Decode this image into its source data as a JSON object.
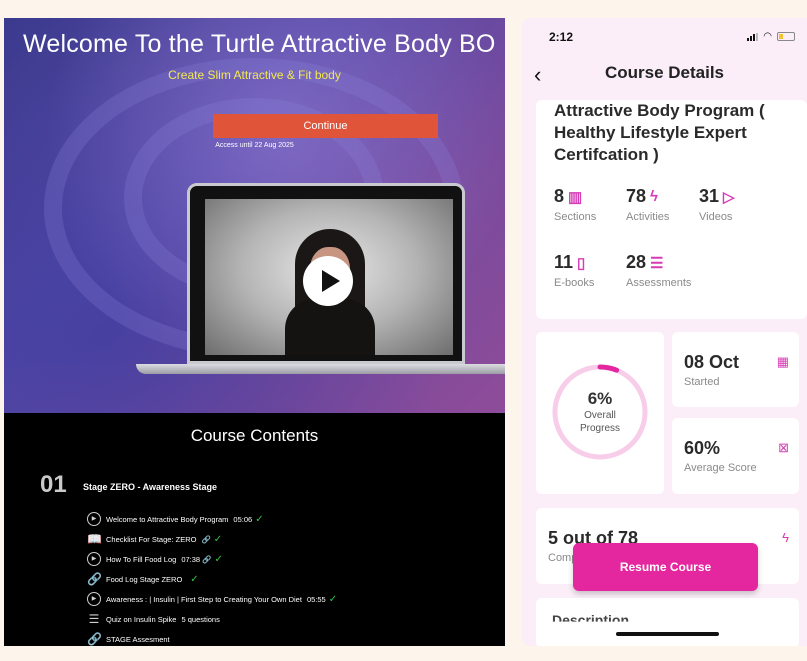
{
  "left": {
    "hero": {
      "title": "Welcome To the Turtle Attractive Body BO",
      "subtitle": "Create Slim Attractive & Fit body",
      "cta_label": "Continue",
      "access_text": "Access until 22 Aug 2025"
    },
    "contents": {
      "heading": "Course Contents",
      "section": {
        "number": "01",
        "title": "Stage ZERO - Awareness Stage"
      },
      "lessons": [
        {
          "icon": "play-circle-icon",
          "title": "Welcome to Attractive Body Program",
          "duration": "05:06",
          "check": "✓"
        },
        {
          "icon": "book-icon",
          "title": "Checklist For Stage: ZERO",
          "duration": "🔗",
          "check": "✓"
        },
        {
          "icon": "play-circle-icon",
          "title": "How To Fill Food Log",
          "duration": "07:38 🔗",
          "check": "✓"
        },
        {
          "icon": "link-icon",
          "title": "Food Log Stage ZERO",
          "duration": "",
          "check": "✓"
        },
        {
          "icon": "play-circle-icon",
          "title": "Awareness : | Insulin | First Step to Creating Your Own Diet",
          "duration": "05:55",
          "check": "✓"
        },
        {
          "icon": "quiz-icon",
          "title": "Quiz on Insulin Spike",
          "duration": "5 questions",
          "check": ""
        },
        {
          "icon": "link-icon",
          "title": "STAGE Assesment",
          "duration": "",
          "check": ""
        }
      ]
    }
  },
  "right": {
    "status_time": "2:12",
    "nav_title": "Course Details",
    "back_glyph": "‹",
    "course_title": "Attractive Body Program ( Healthy Lifestyle Expert Certifcation )",
    "stats": [
      {
        "value": "8",
        "label": "Sections",
        "icon": "columns-icon",
        "glyph": "▥"
      },
      {
        "value": "78",
        "label": "Activities",
        "icon": "lightning-icon",
        "glyph": "ϟ"
      },
      {
        "value": "31",
        "label": "Videos",
        "icon": "play-icon",
        "glyph": "▷"
      },
      {
        "value": "11",
        "label": "E-books",
        "icon": "book-icon",
        "glyph": "▯"
      },
      {
        "value": "28",
        "label": "Assessments",
        "icon": "checklist-icon",
        "glyph": "☰"
      }
    ],
    "progress": {
      "value": "6%",
      "label_line1": "Overall",
      "label_line2": "Progress",
      "fraction": 0.06
    },
    "started": {
      "value": "08 Oct",
      "label": "Started",
      "icon": "calendar-icon",
      "glyph": "▦"
    },
    "score": {
      "value": "60%",
      "label": "Average Score",
      "icon": "percent-icon",
      "glyph": "⊠"
    },
    "activities": {
      "value": "5 out of 78",
      "label": "Comp",
      "icon": "lightning-icon",
      "glyph": "ϟ"
    },
    "description_heading": "Description",
    "resume_label": "Resume Course",
    "accent_color": "#e4269f"
  }
}
